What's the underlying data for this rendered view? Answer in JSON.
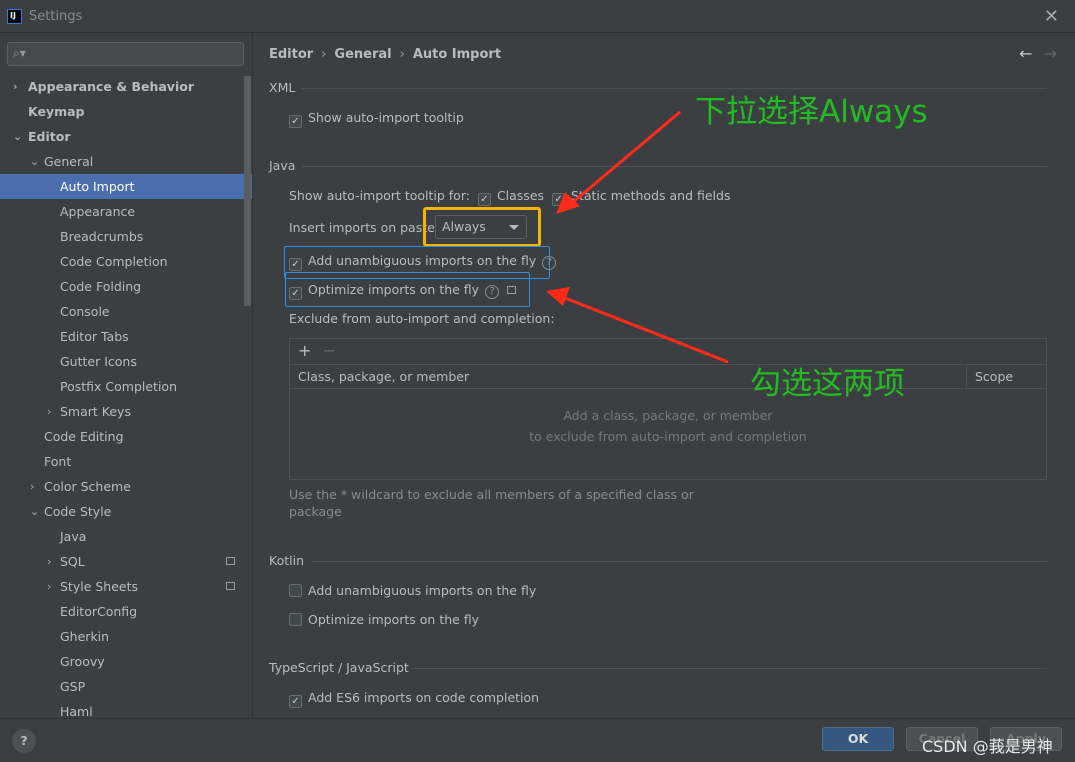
{
  "window": {
    "title": "Settings",
    "logo": "IJ"
  },
  "search": {
    "placeholder": "Q▾"
  },
  "sidebar": {
    "items": [
      {
        "label": "Appearance & Behavior",
        "level": 0,
        "arrow": "›",
        "bold": true
      },
      {
        "label": "Keymap",
        "level": 0,
        "arrow": "",
        "bold": true
      },
      {
        "label": "Editor",
        "level": 0,
        "arrow": "⌄",
        "bold": true
      },
      {
        "label": "General",
        "level": 1,
        "arrow": "⌄"
      },
      {
        "label": "Auto Import",
        "level": 2,
        "arrow": "",
        "selected": true
      },
      {
        "label": "Appearance",
        "level": 2,
        "arrow": ""
      },
      {
        "label": "Breadcrumbs",
        "level": 2,
        "arrow": ""
      },
      {
        "label": "Code Completion",
        "level": 2,
        "arrow": ""
      },
      {
        "label": "Code Folding",
        "level": 2,
        "arrow": ""
      },
      {
        "label": "Console",
        "level": 2,
        "arrow": ""
      },
      {
        "label": "Editor Tabs",
        "level": 2,
        "arrow": ""
      },
      {
        "label": "Gutter Icons",
        "level": 2,
        "arrow": ""
      },
      {
        "label": "Postfix Completion",
        "level": 2,
        "arrow": ""
      },
      {
        "label": "Smart Keys",
        "level": 2,
        "arrow": "›"
      },
      {
        "label": "Code Editing",
        "level": 1,
        "arrow": ""
      },
      {
        "label": "Font",
        "level": 1,
        "arrow": ""
      },
      {
        "label": "Color Scheme",
        "level": 1,
        "arrow": "›"
      },
      {
        "label": "Code Style",
        "level": 1,
        "arrow": "⌄"
      },
      {
        "label": "Java",
        "level": 2,
        "arrow": ""
      },
      {
        "label": "SQL",
        "level": 2,
        "arrow": "›",
        "mini": true
      },
      {
        "label": "Style Sheets",
        "level": 2,
        "arrow": "›",
        "mini": true
      },
      {
        "label": "EditorConfig",
        "level": 2,
        "arrow": ""
      },
      {
        "label": "Gherkin",
        "level": 2,
        "arrow": ""
      },
      {
        "label": "Groovy",
        "level": 2,
        "arrow": ""
      },
      {
        "label": "GSP",
        "level": 2,
        "arrow": ""
      },
      {
        "label": "Haml",
        "level": 2,
        "arrow": ""
      }
    ]
  },
  "breadcrumb": [
    "Editor",
    "General",
    "Auto Import"
  ],
  "xml": {
    "title": "XML",
    "show_tooltip": "Show auto-import tooltip"
  },
  "java": {
    "title": "Java",
    "tooltip_for": "Show auto-import tooltip for:",
    "classes": "Classes",
    "static": "Static methods and fields",
    "insert_label": "Insert imports on paste:",
    "insert_value": "Always",
    "add_unambiguous": "Add unambiguous imports on the fly",
    "optimize": "Optimize imports on the fly",
    "exclude_label": "Exclude from auto-import and completion:",
    "col_class": "Class, package, or member",
    "col_scope": "Scope",
    "empty1": "Add a class, package, or member",
    "empty2": "to exclude from auto-import and completion",
    "hint1": "Use the * wildcard to exclude all members of a specified class or",
    "hint2": "package"
  },
  "kotlin": {
    "title": "Kotlin",
    "add_unambiguous": "Add unambiguous imports on the fly",
    "optimize": "Optimize imports on the fly"
  },
  "ts": {
    "title": "TypeScript / JavaScript",
    "add_es6": "Add ES6 imports on code completion"
  },
  "buttons": {
    "ok": "OK",
    "cancel": "Cancel",
    "apply": "Apply",
    "help": "?"
  },
  "annotations": {
    "select_always": "下拉选择Always",
    "check_both": "勾选这两项",
    "watermark": "CSDN @莪是男神"
  },
  "colors": {
    "selection": "#4b6eaf",
    "annotation_arrow": "#ff2a1a",
    "annotation_text": "#22bb22",
    "highlight_orange": "#f5b400",
    "highlight_blue": "#2a8fe0"
  }
}
